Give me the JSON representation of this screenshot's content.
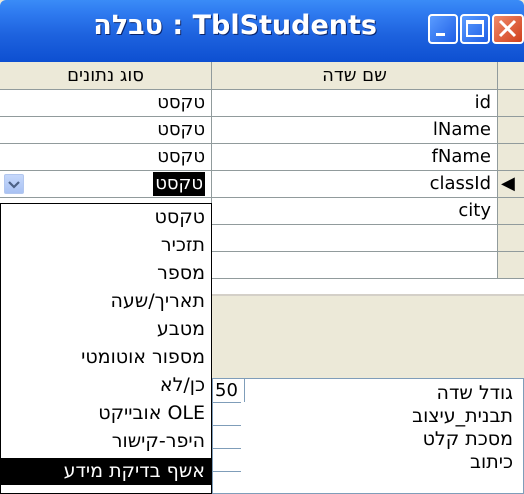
{
  "window": {
    "title": "טבלה : TblStudents",
    "buttons": {
      "minimize": "minimize",
      "maximize": "maximize",
      "close": "close"
    }
  },
  "grid": {
    "columns": {
      "data_type": "סוג נתונים",
      "field_name": "שם שדה"
    },
    "rows": [
      {
        "field_name": "id",
        "data_type": "טקסט"
      },
      {
        "field_name": "lName",
        "data_type": "טקסט"
      },
      {
        "field_name": "fName",
        "data_type": "טקסט"
      },
      {
        "field_name": "classId",
        "data_type": "טקסט"
      },
      {
        "field_name": "city",
        "data_type": ""
      }
    ],
    "current_row_indicator": "◀"
  },
  "dropdown": {
    "items": [
      "טקסט",
      "תזכיר",
      "מספר",
      "תאריך/שעה",
      "מטבע",
      "מספור אוטומטי",
      "כן/לא",
      "OLE אובייקט",
      "היפר-קישור",
      "אשף בדיקת מידע"
    ],
    "highlighted_index": 9
  },
  "properties": {
    "field_size_value": "50",
    "labels": [
      "גודל שדה",
      "תבנית_עיצוב",
      "מסכת קלט",
      "כיתוב"
    ]
  },
  "colors": {
    "titlebar": "#0d4fd1",
    "face": "#ece9d8",
    "grid_line": "#919b9c"
  }
}
